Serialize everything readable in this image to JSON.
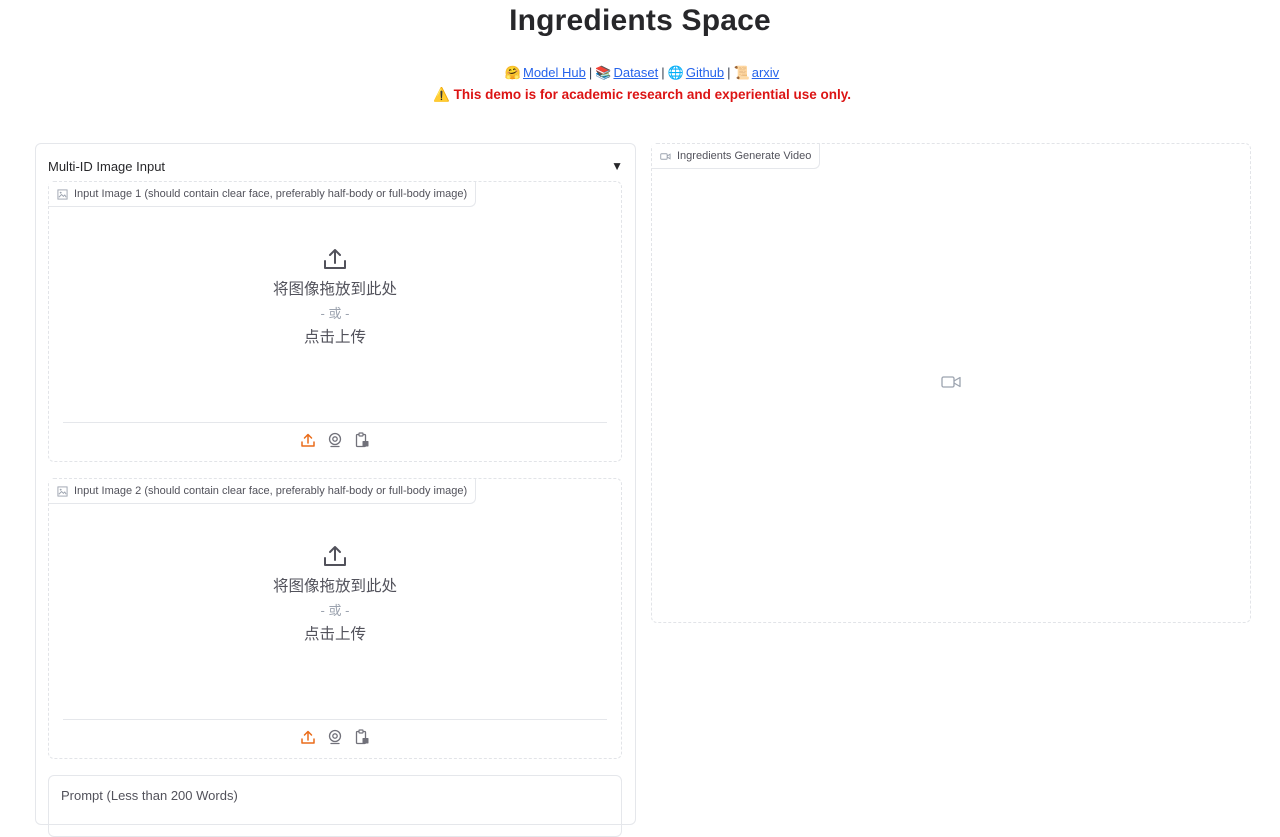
{
  "header": {
    "title": "Ingredients Space",
    "links": [
      {
        "emoji": "🤗",
        "label": "Model Hub"
      },
      {
        "emoji": "📚",
        "label": "Dataset"
      },
      {
        "emoji": "🌐",
        "label": "Github"
      },
      {
        "emoji": "📜",
        "label": "arxiv"
      }
    ],
    "separator": "|",
    "warning": "⚠️ This demo is for academic research and experiential use only."
  },
  "left": {
    "accordion_title": "Multi-ID Image Input",
    "accordion_arrow": "▼",
    "image_inputs": [
      {
        "label": "Input Image 1 (should contain clear face, preferably half-body or full-body image)",
        "drop_text": "将图像拖放到此处",
        "or_text": "- 或 -",
        "click_text": "点击上传"
      },
      {
        "label": "Input Image 2 (should contain clear face, preferably half-body or full-body image)",
        "drop_text": "将图像拖放到此处",
        "or_text": "- 或 -",
        "click_text": "点击上传"
      }
    ],
    "source_icons": [
      "upload-icon",
      "webcam-icon",
      "clipboard-icon"
    ],
    "prompt_label": "Prompt (Less than 200 Words)"
  },
  "right": {
    "video_label": "Ingredients Generate Video",
    "placeholder_icon": "video-camera-icon"
  },
  "colors": {
    "accent_orange": "#ea6c1a",
    "warning_red": "#dc1414",
    "link_blue": "#2563eb"
  }
}
